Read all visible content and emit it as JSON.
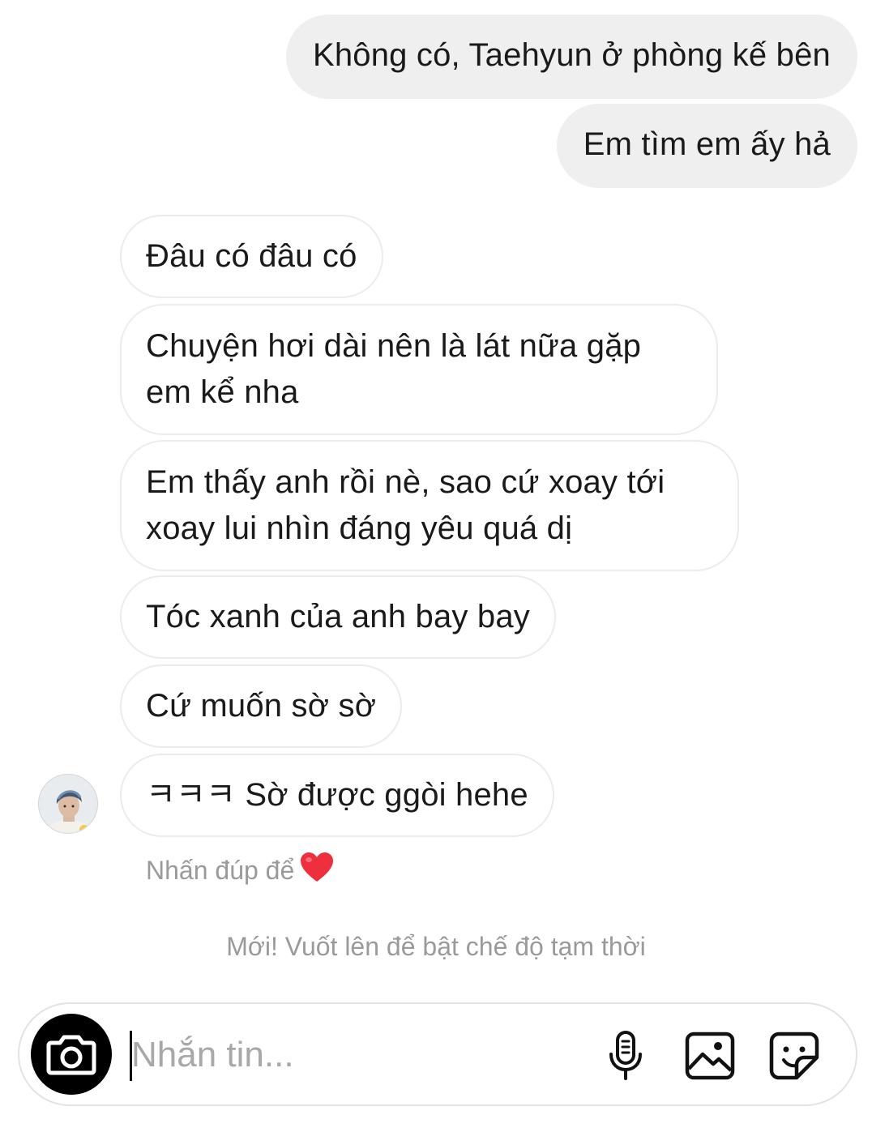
{
  "messages": {
    "outgoing": [
      "Không có, Taehyun ở phòng kế bên",
      "Em tìm em ấy hả"
    ],
    "incoming": [
      "Đâu có đâu có",
      "Chuyện hơi dài nên là lát nữa gặp em kể nha",
      "Em thấy anh rồi nè, sao cứ xoay tới xoay lui nhìn đáng yêu quá dị",
      "Tóc xanh của anh bay bay",
      "Cứ muốn sờ sờ",
      "ㅋㅋㅋ Sờ được ggòi hehe"
    ]
  },
  "hint": {
    "text": "Nhấn đúp để",
    "icon": "heart-icon",
    "icon_color": "#ed2f3e"
  },
  "notice": "Mới! Vuốt lên để bật chế độ tạm thời",
  "composer": {
    "placeholder": "Nhắn tin...",
    "icons": [
      "camera-icon",
      "microphone-icon",
      "image-icon",
      "sticker-icon"
    ]
  }
}
